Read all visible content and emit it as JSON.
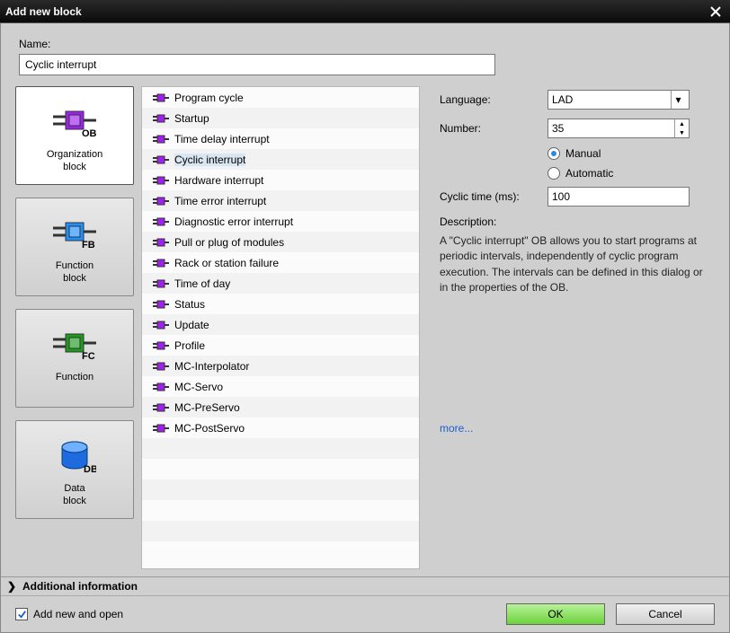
{
  "title": "Add new block",
  "name_label": "Name:",
  "name_value": "Cyclic interrupt",
  "block_types": [
    {
      "label": "Organization block",
      "code": "OB",
      "color": "#a020f0"
    },
    {
      "label": "Function block",
      "code": "FB",
      "color": "#1e90ff"
    },
    {
      "label": "Function",
      "code": "FC",
      "color": "#1c9c1c"
    },
    {
      "label": "Data block",
      "code": "DB",
      "color": "#1e6be0"
    }
  ],
  "selected_block_type": 0,
  "ob_list": [
    "Program cycle",
    "Startup",
    "Time delay interrupt",
    "Cyclic interrupt",
    "Hardware interrupt",
    "Time error interrupt",
    "Diagnostic error interrupt",
    "Pull or plug of modules",
    "Rack or station failure",
    "Time of day",
    "Status",
    "Update",
    "Profile",
    "MC-Interpolator",
    "MC-Servo",
    "MC-PreServo",
    "MC-PostServo"
  ],
  "selected_ob": 3,
  "right": {
    "language_label": "Language:",
    "language_value": "LAD",
    "number_label": "Number:",
    "number_value": "35",
    "manual_label": "Manual",
    "automatic_label": "Automatic",
    "number_mode": "manual",
    "cyclic_label": "Cyclic time (ms):",
    "cyclic_value": "100",
    "desc_header": "Description:",
    "desc_text": "A \"Cyclic interrupt\" OB allows you to start programs at periodic intervals, independently of cyclic program execution. The intervals can be defined in this dialog or in the properties of the OB.",
    "more": "more..."
  },
  "additional_info": "Additional information",
  "add_open_label": "Add new and open",
  "add_open_checked": true,
  "ok_label": "OK",
  "cancel_label": "Cancel"
}
